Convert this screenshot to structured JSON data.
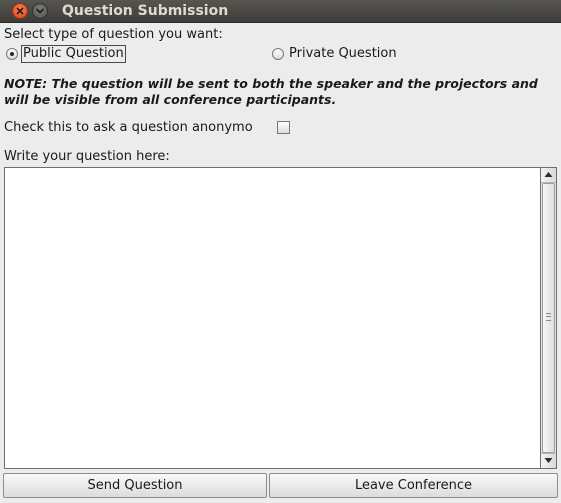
{
  "window": {
    "title": "Question Submission"
  },
  "question_type": {
    "label": "Select type of question you want:",
    "options": [
      {
        "label": "Public Question",
        "selected": true
      },
      {
        "label": "Private Question",
        "selected": false
      }
    ]
  },
  "note": "NOTE: The question will be sent to both the speaker and the projectors and will be visible from all conference participants.",
  "anonymous": {
    "label": "Check this to ask a question anonymo",
    "checked": false
  },
  "question": {
    "label": "Write your question here:",
    "value": ""
  },
  "buttons": {
    "send": "Send Question",
    "leave": "Leave Conference"
  },
  "icons": {
    "close": "close-icon",
    "minimize": "minimize-icon",
    "scroll_up": "arrow-up-icon",
    "scroll_down": "arrow-down-icon"
  },
  "colors": {
    "titlebar": "#3d3c38",
    "close_button": "#d9441a",
    "window_bg": "#ececec"
  }
}
